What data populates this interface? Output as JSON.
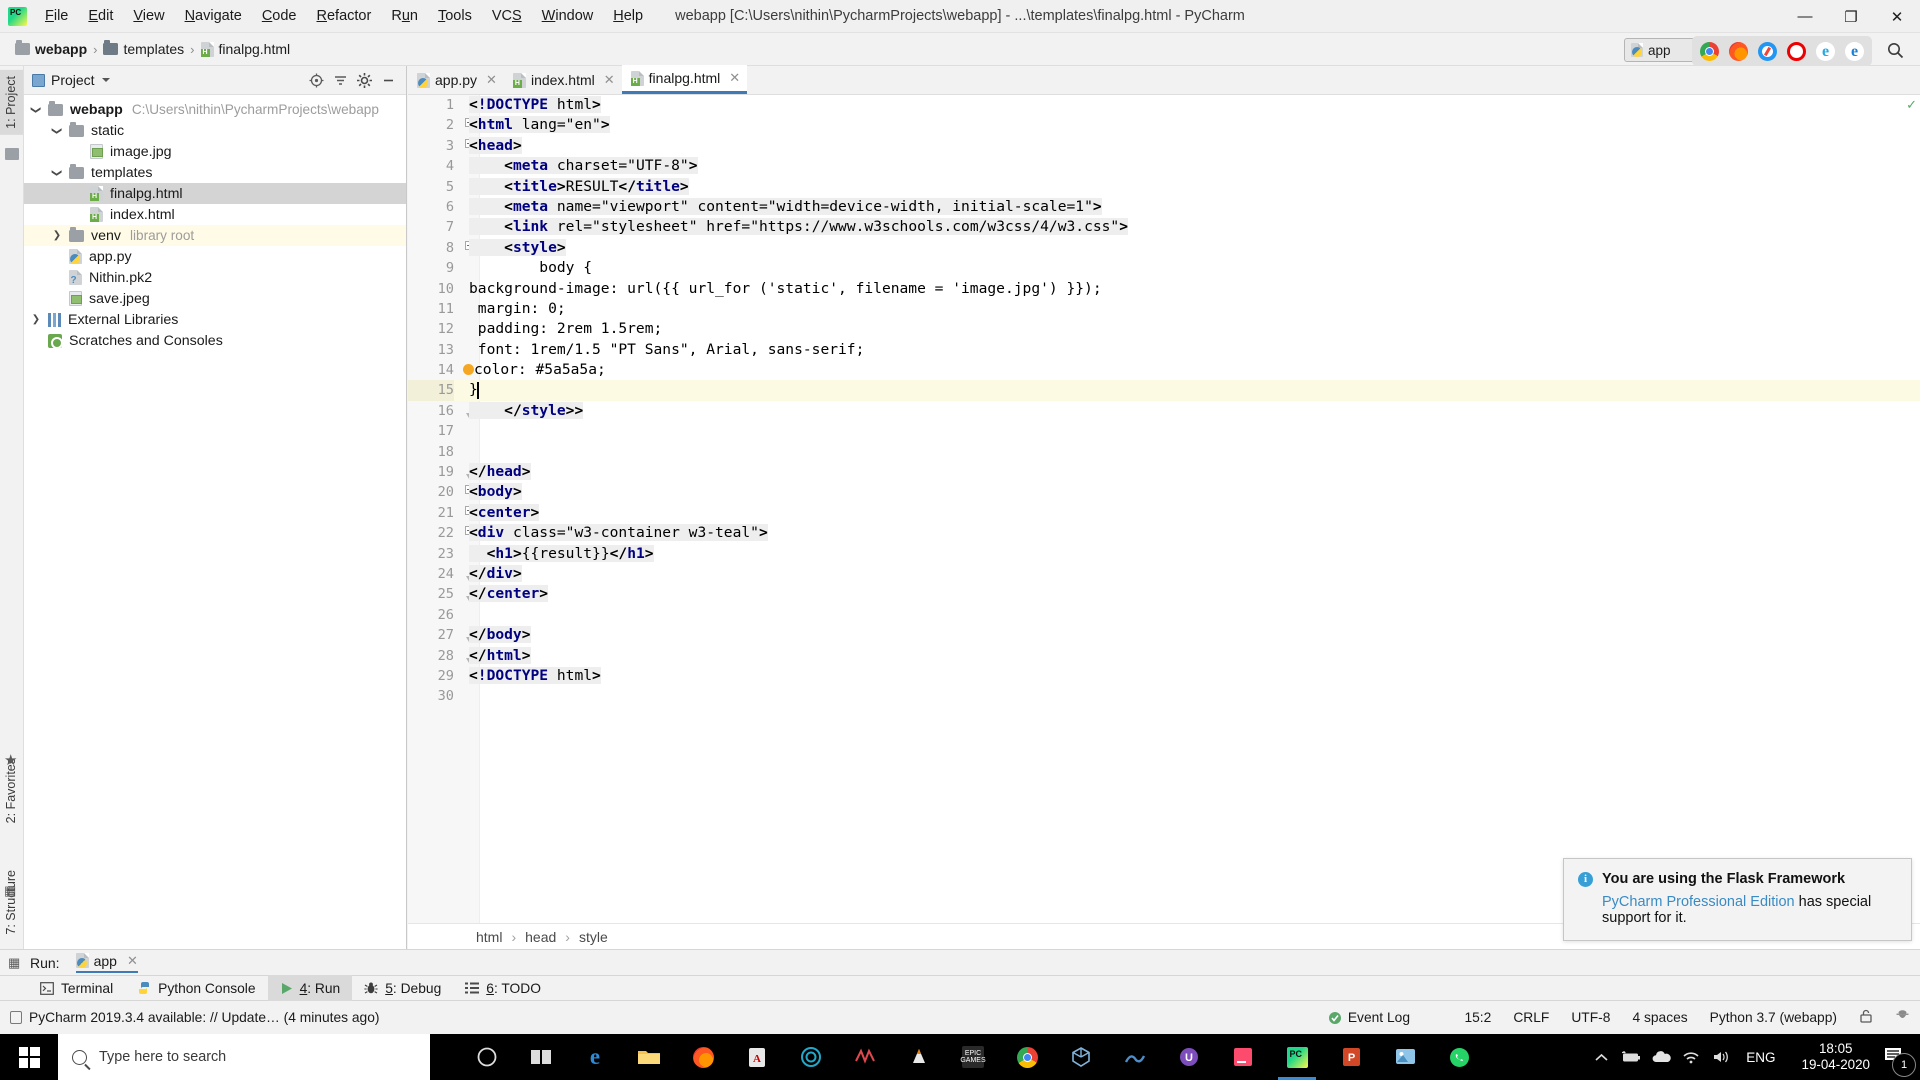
{
  "window": {
    "title": "webapp [C:\\Users\\nithin\\PycharmProjects\\webapp] - ...\\templates\\finalpg.html - PyCharm",
    "minimize": "—",
    "maximize": "❐",
    "close": "✕"
  },
  "menu": [
    "File",
    "Edit",
    "View",
    "Navigate",
    "Code",
    "Refactor",
    "Run",
    "Tools",
    "VCS",
    "Window",
    "Help"
  ],
  "breadcrumb": [
    {
      "label": "webapp",
      "icon": "folder-icon"
    },
    {
      "label": "templates",
      "icon": "folder-icon"
    },
    {
      "label": "finalpg.html",
      "icon": "html-file-icon"
    }
  ],
  "toolbar": {
    "run_config": "app",
    "run": "run-icon",
    "debug": "debug-icon",
    "coverage": "coverage-icon",
    "stop": "stop-icon",
    "search": "search-icon"
  },
  "left_stripes": [
    {
      "label": "1: Project",
      "active": true
    },
    {
      "label": "2: Favorites",
      "active": false
    },
    {
      "label": "7: Structure",
      "active": false
    }
  ],
  "project": {
    "title": "Project",
    "tree": [
      {
        "label": "webapp",
        "meta": "C:\\Users\\nithin\\PycharmProjects\\webapp",
        "indent": 0,
        "twist": "down",
        "icon": "folder-icon",
        "bold": true,
        "state": ""
      },
      {
        "label": "static",
        "meta": "",
        "indent": 1,
        "twist": "down",
        "icon": "folder-icon",
        "bold": false,
        "state": ""
      },
      {
        "label": "image.jpg",
        "meta": "",
        "indent": 2,
        "twist": "none",
        "icon": "image-file-icon",
        "bold": false,
        "state": ""
      },
      {
        "label": "templates",
        "meta": "",
        "indent": 1,
        "twist": "down",
        "icon": "folder-icon",
        "bold": false,
        "state": ""
      },
      {
        "label": "finalpg.html",
        "meta": "",
        "indent": 2,
        "twist": "none",
        "icon": "html-file-icon",
        "bold": false,
        "state": "selected"
      },
      {
        "label": "index.html",
        "meta": "",
        "indent": 2,
        "twist": "none",
        "icon": "html-file-icon",
        "bold": false,
        "state": ""
      },
      {
        "label": "venv",
        "meta": "library root",
        "indent": 1,
        "twist": "right",
        "icon": "folder-icon",
        "bold": false,
        "state": "venv"
      },
      {
        "label": "app.py",
        "meta": "",
        "indent": 1,
        "twist": "none",
        "icon": "python-file-icon",
        "bold": false,
        "state": ""
      },
      {
        "label": "Nithin.pk2",
        "meta": "",
        "indent": 1,
        "twist": "none",
        "icon": "unknown-file-icon",
        "bold": false,
        "state": ""
      },
      {
        "label": "save.jpeg",
        "meta": "",
        "indent": 1,
        "twist": "none",
        "icon": "image-file-icon",
        "bold": false,
        "state": ""
      },
      {
        "label": "External Libraries",
        "meta": "",
        "indent": 0,
        "twist": "right",
        "icon": "library-icon",
        "bold": false,
        "state": ""
      },
      {
        "label": "Scratches and Consoles",
        "meta": "",
        "indent": 0,
        "twist": "none",
        "icon": "scratches-icon",
        "bold": false,
        "state": ""
      }
    ]
  },
  "editor_tabs": [
    {
      "label": "app.py",
      "icon": "python-file-icon",
      "active": false
    },
    {
      "label": "index.html",
      "icon": "html-file-icon",
      "active": false
    },
    {
      "label": "finalpg.html",
      "icon": "html-file-icon",
      "active": true
    }
  ],
  "browsers": [
    "chrome-icon",
    "firefox-icon",
    "safari-icon",
    "opera-icon",
    "ie-icon",
    "edge-icon"
  ],
  "code": {
    "lines": [
      {
        "n": 1,
        "fold": "",
        "caret": false,
        "text": "<!DOCTYPE html>"
      },
      {
        "n": 2,
        "fold": "open",
        "caret": false,
        "text": "<html lang=\"en\">"
      },
      {
        "n": 3,
        "fold": "open",
        "caret": false,
        "text": "<head>"
      },
      {
        "n": 4,
        "fold": "",
        "caret": false,
        "text": "    <meta charset=\"UTF-8\">"
      },
      {
        "n": 5,
        "fold": "",
        "caret": false,
        "text": "    <title>RESULT</title>"
      },
      {
        "n": 6,
        "fold": "",
        "caret": false,
        "text": "    <meta name=\"viewport\" content=\"width=device-width, initial-scale=1\">"
      },
      {
        "n": 7,
        "fold": "",
        "caret": false,
        "text": "    <link rel=\"stylesheet\" href=\"https://www.w3schools.com/w3css/4/w3.css\">"
      },
      {
        "n": 8,
        "fold": "open",
        "caret": false,
        "text": "    <style>"
      },
      {
        "n": 9,
        "fold": "",
        "caret": false,
        "text": "        body {"
      },
      {
        "n": 10,
        "fold": "",
        "caret": false,
        "text": "background-image: url({{ url_for ('static', filename = 'image.jpg') }});"
      },
      {
        "n": 11,
        "fold": "",
        "caret": false,
        "text": " margin: 0;"
      },
      {
        "n": 12,
        "fold": "",
        "caret": false,
        "text": " padding: 2rem 1.5rem;"
      },
      {
        "n": 13,
        "fold": "",
        "caret": false,
        "text": " font: 1rem/1.5 \"PT Sans\", Arial, sans-serif;"
      },
      {
        "n": 14,
        "fold": "",
        "caret": false,
        "text": " color: #5a5a5a;"
      },
      {
        "n": 15,
        "fold": "",
        "caret": true,
        "text": "}"
      },
      {
        "n": 16,
        "fold": "close",
        "caret": false,
        "text": "    </style>>"
      },
      {
        "n": 17,
        "fold": "",
        "caret": false,
        "text": ""
      },
      {
        "n": 18,
        "fold": "",
        "caret": false,
        "text": ""
      },
      {
        "n": 19,
        "fold": "close",
        "caret": false,
        "text": "</head>"
      },
      {
        "n": 20,
        "fold": "open",
        "caret": false,
        "text": "<body>"
      },
      {
        "n": 21,
        "fold": "open",
        "caret": false,
        "text": "<center>"
      },
      {
        "n": 22,
        "fold": "open",
        "caret": false,
        "text": "<div class=\"w3-container w3-teal\">"
      },
      {
        "n": 23,
        "fold": "",
        "caret": false,
        "text": "  <h1>{{result}}</h1>"
      },
      {
        "n": 24,
        "fold": "close",
        "caret": false,
        "text": "</div>"
      },
      {
        "n": 25,
        "fold": "close",
        "caret": false,
        "text": "</center>"
      },
      {
        "n": 26,
        "fold": "",
        "caret": false,
        "text": ""
      },
      {
        "n": 27,
        "fold": "close",
        "caret": false,
        "text": "</body>"
      },
      {
        "n": 28,
        "fold": "close",
        "caret": false,
        "text": "</html>"
      },
      {
        "n": 29,
        "fold": "",
        "caret": false,
        "text": "<!DOCTYPE html>"
      },
      {
        "n": 30,
        "fold": "",
        "caret": false,
        "text": ""
      }
    ],
    "color_swatch_line": 14,
    "color_swatch_value": "#f5a623"
  },
  "editor_breadcrumb": [
    "html",
    "head",
    "style"
  ],
  "notification": {
    "icon": "info-icon",
    "title": "You are using the Flask Framework",
    "link": "PyCharm Professional Edition",
    "body_rest": " has special support for it."
  },
  "run_panel": {
    "label": "Run:",
    "tab": "app",
    "close": "✕"
  },
  "tool_windows": [
    {
      "label": "Terminal",
      "icon": "terminal-icon",
      "active": false
    },
    {
      "label": "Python Console",
      "icon": "python-icon",
      "active": false
    },
    {
      "label": "4: Run",
      "icon": "run-icon",
      "active": true
    },
    {
      "label": "5: Debug",
      "icon": "debug-icon",
      "active": false
    },
    {
      "label": "6: TODO",
      "icon": "todo-icon",
      "active": false
    }
  ],
  "statusbar": {
    "left": "PyCharm 2019.3.4 available: // Update… (4 minutes ago)",
    "right": [
      "15:2",
      "CRLF",
      "UTF-8",
      "4 spaces",
      "Python 3.7 (webapp)"
    ],
    "event_log": "Event Log"
  },
  "taskbar": {
    "search_placeholder": "Type here to search",
    "cortana": "cortana-icon",
    "taskview": "task-view-icon",
    "apps": [
      "edge-icon",
      "file-explorer-icon",
      "firefox-icon",
      "acrobat-icon",
      "spiral-icon",
      "music-icon",
      "vlc-icon",
      "epic-games-icon",
      "chrome-icon",
      "sandbox-icon",
      "nord-icon",
      "uget-icon",
      "jetbrains-toolbox-icon",
      "pycharm-icon",
      "powerpoint-icon",
      "photos-icon",
      "whatsapp-icon"
    ],
    "tray": [
      "show-hidden-icon",
      "battery-icon",
      "onedrive-icon",
      "wifi-icon",
      "volume-icon"
    ],
    "language": "ENG",
    "time": "18:05",
    "date": "19-04-2020",
    "notification_count": "1"
  },
  "colors": {
    "accent": "#3e7ab5",
    "tag": "#000080",
    "attr": "#0b7a0b",
    "green_run": "#59a869",
    "notif_link": "#3a8bc4"
  }
}
